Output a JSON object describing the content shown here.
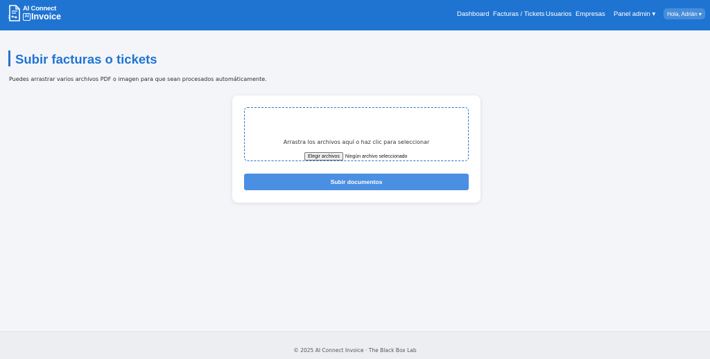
{
  "brand": {
    "line1": "AI Connect",
    "line2_chip": "AI",
    "line2": "Invoice",
    "color": "#1f74d2"
  },
  "nav": {
    "dashboard": "Dashboard",
    "facturas": "Facturas / Tickets",
    "usuarios": "Usuarios",
    "empresas": "Empresas",
    "admin": "Panel admin ▾",
    "user": "Hola, Adrián ▾"
  },
  "page": {
    "title": "Subir facturas o tickets",
    "subtitle": "Puedes arrastrar varios archivos PDF o imagen para que sean procesados automáticamente."
  },
  "upload": {
    "dropzone_text": "Arrastra los archivos aquí o haz clic para seleccionar",
    "choose_button": "Elegir archivos",
    "file_status": "Ningún archivo seleccionado",
    "submit_button": "Subir documentos",
    "submit_color": "#4a8fe2"
  },
  "footer": {
    "text": "© 2025 AI Connect Invoice · The Black Box Lab"
  }
}
